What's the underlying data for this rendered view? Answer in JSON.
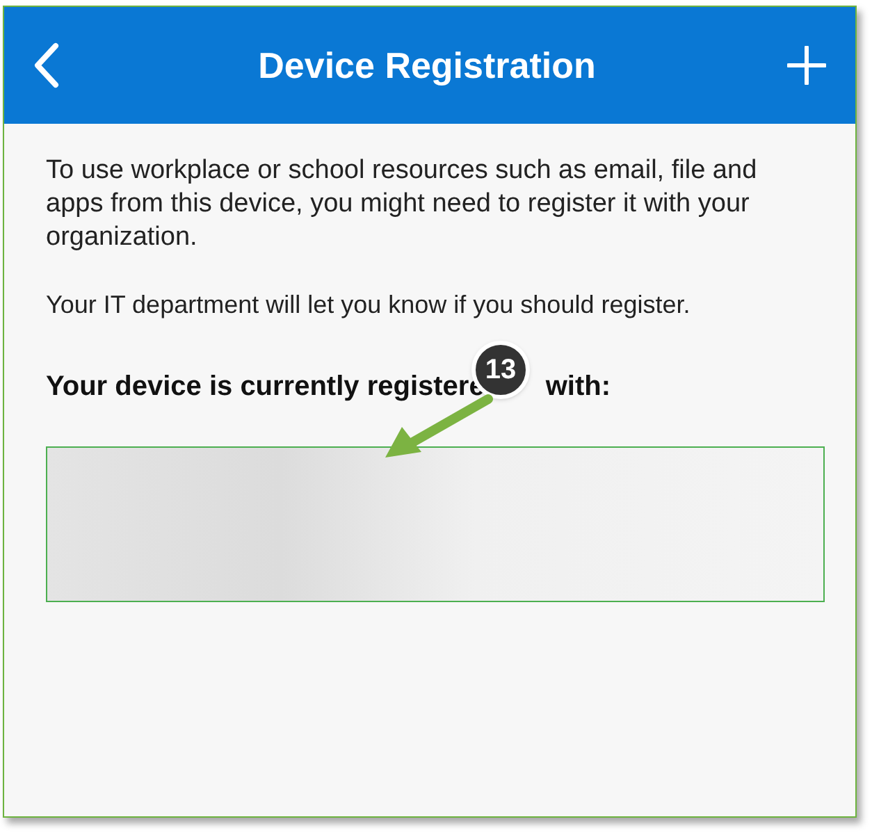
{
  "header": {
    "title": "Device Registration"
  },
  "intro": "To use workplace or school resources such as email, file and apps from this device, you might need to register it with your organization.",
  "note": "Your IT department will let you know if you should register.",
  "heading": {
    "before": "Your device is currently registere",
    "after": "with:"
  },
  "callout": {
    "number": "13"
  }
}
